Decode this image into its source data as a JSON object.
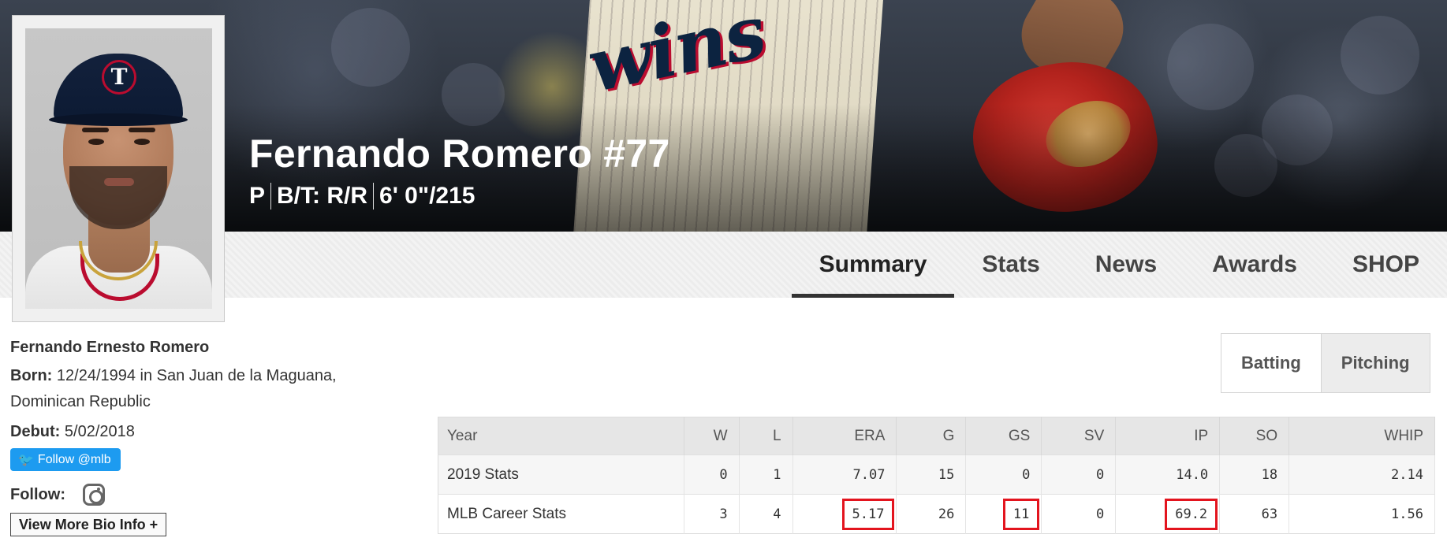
{
  "player": {
    "display_name": "Fernando Romero #77",
    "position": "P",
    "bats_throws": "B/T: R/R",
    "height_weight": "6' 0\"/215",
    "headshot_cap_logo": "T"
  },
  "nav": {
    "tabs": [
      "Summary",
      "Stats",
      "News",
      "Awards",
      "SHOP"
    ],
    "active": "Summary"
  },
  "bio": {
    "full_name": "Fernando Ernesto Romero",
    "born_label": "Born:",
    "born_value": "12/24/1994 in San Juan de la Maguana, Dominican Republic",
    "debut_label": "Debut:",
    "debut_value": "5/02/2018",
    "twitter_button": "Follow @mlb",
    "follow_label": "Follow:",
    "view_more": "View More Bio Info +"
  },
  "toggle": {
    "options": [
      "Batting",
      "Pitching"
    ],
    "selected": "Pitching"
  },
  "stats_table": {
    "columns": [
      "Year",
      "W",
      "L",
      "ERA",
      "G",
      "GS",
      "SV",
      "IP",
      "SO",
      "WHIP"
    ],
    "rows": [
      [
        "2019 Stats",
        "0",
        "1",
        "7.07",
        "15",
        "0",
        "0",
        "14.0",
        "18",
        "2.14"
      ],
      [
        "MLB Career Stats",
        "3",
        "4",
        "5.17",
        "26",
        "11",
        "0",
        "69.2",
        "63",
        "1.56"
      ]
    ],
    "highlighted": [
      "ERA",
      "GS",
      "IP"
    ],
    "highlight_color": "#e3141e"
  },
  "icons": {
    "twitter": "twitter-bird-icon",
    "instagram": "instagram-icon"
  },
  "colors": {
    "twitter_blue": "#1d9bf0",
    "twins_navy": "#0c2340",
    "twins_red": "#ba0c2f"
  }
}
